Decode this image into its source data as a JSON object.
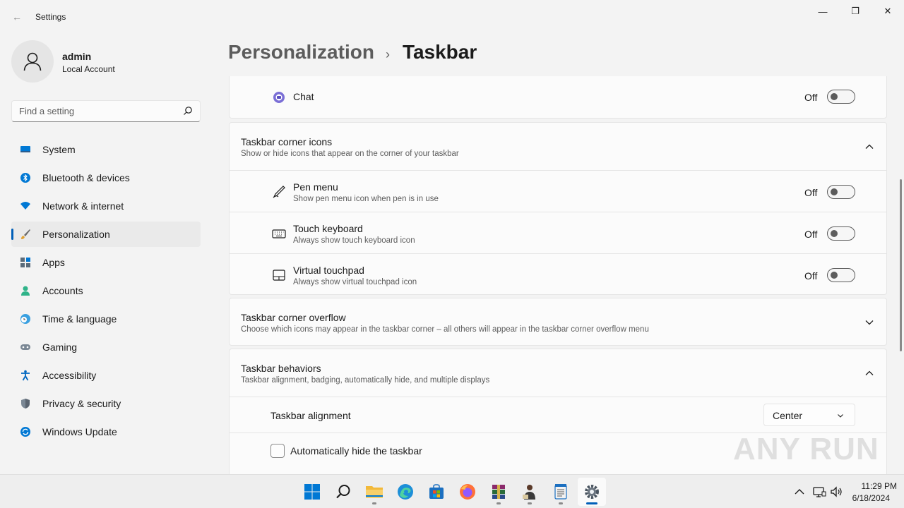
{
  "window": {
    "title": "Settings",
    "back_glyph": "←",
    "minimize_glyph": "—",
    "maximize_glyph": "❐",
    "close_glyph": "✕"
  },
  "profile": {
    "name": "admin",
    "account_type": "Local Account"
  },
  "search": {
    "placeholder": "Find a setting",
    "icon": "search-icon"
  },
  "sidebar": {
    "items": [
      {
        "label": "System",
        "icon": "system-icon"
      },
      {
        "label": "Bluetooth & devices",
        "icon": "bluetooth-icon"
      },
      {
        "label": "Network & internet",
        "icon": "wifi-icon"
      },
      {
        "label": "Personalization",
        "icon": "brush-icon",
        "active": true
      },
      {
        "label": "Apps",
        "icon": "apps-icon"
      },
      {
        "label": "Accounts",
        "icon": "accounts-icon"
      },
      {
        "label": "Time & language",
        "icon": "clock-globe-icon"
      },
      {
        "label": "Gaming",
        "icon": "gamepad-icon"
      },
      {
        "label": "Accessibility",
        "icon": "accessibility-icon"
      },
      {
        "label": "Privacy & security",
        "icon": "shield-icon"
      },
      {
        "label": "Windows Update",
        "icon": "update-icon"
      }
    ]
  },
  "breadcrumb": {
    "parent": "Personalization",
    "separator": "›",
    "current": "Taskbar"
  },
  "settings": {
    "chat": {
      "label": "Chat",
      "state": "Off"
    },
    "corner_icons": {
      "title": "Taskbar corner icons",
      "description": "Show or hide icons that appear on the corner of your taskbar",
      "items": [
        {
          "label": "Pen menu",
          "description": "Show pen menu icon when pen is in use",
          "state": "Off"
        },
        {
          "label": "Touch keyboard",
          "description": "Always show touch keyboard icon",
          "state": "Off"
        },
        {
          "label": "Virtual touchpad",
          "description": "Always show virtual touchpad icon",
          "state": "Off"
        }
      ]
    },
    "corner_overflow": {
      "title": "Taskbar corner overflow",
      "description": "Choose which icons may appear in the taskbar corner – all others will appear in the taskbar corner overflow menu"
    },
    "behaviors": {
      "title": "Taskbar behaviors",
      "description": "Taskbar alignment, badging, automatically hide, and multiple displays",
      "alignment_label": "Taskbar alignment",
      "alignment_value": "Center",
      "autohide_label": "Automatically hide the taskbar"
    }
  },
  "watermark": "ANY RUN",
  "taskbar": {
    "apps": [
      "start-icon",
      "search-icon",
      "file-explorer-icon",
      "edge-icon",
      "store-icon",
      "firefox-icon",
      "winrar-icon",
      "app-person-icon",
      "notepad-icon",
      "settings-icon"
    ],
    "time": "11:29 PM",
    "date": "6/18/2024"
  },
  "colors": {
    "accent": "#005fb8",
    "background": "#f3f3f3",
    "card": "#fbfbfb",
    "border": "#e5e5e5"
  }
}
